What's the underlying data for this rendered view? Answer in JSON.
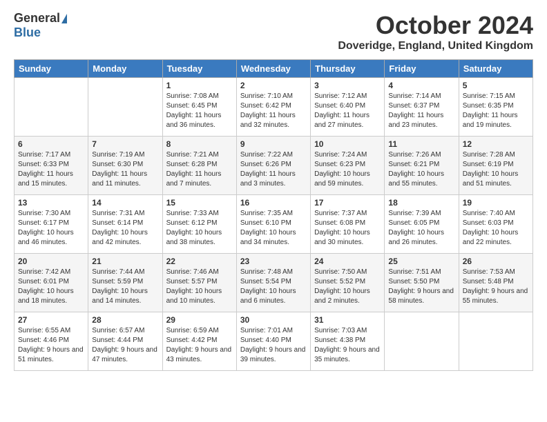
{
  "logo": {
    "general": "General",
    "blue": "Blue"
  },
  "title": "October 2024",
  "location": "Doveridge, England, United Kingdom",
  "days_of_week": [
    "Sunday",
    "Monday",
    "Tuesday",
    "Wednesday",
    "Thursday",
    "Friday",
    "Saturday"
  ],
  "weeks": [
    [
      {
        "day": null,
        "content": null
      },
      {
        "day": null,
        "content": null
      },
      {
        "day": "1",
        "content": "Sunrise: 7:08 AM\nSunset: 6:45 PM\nDaylight: 11 hours and 36 minutes."
      },
      {
        "day": "2",
        "content": "Sunrise: 7:10 AM\nSunset: 6:42 PM\nDaylight: 11 hours and 32 minutes."
      },
      {
        "day": "3",
        "content": "Sunrise: 7:12 AM\nSunset: 6:40 PM\nDaylight: 11 hours and 27 minutes."
      },
      {
        "day": "4",
        "content": "Sunrise: 7:14 AM\nSunset: 6:37 PM\nDaylight: 11 hours and 23 minutes."
      },
      {
        "day": "5",
        "content": "Sunrise: 7:15 AM\nSunset: 6:35 PM\nDaylight: 11 hours and 19 minutes."
      }
    ],
    [
      {
        "day": "6",
        "content": "Sunrise: 7:17 AM\nSunset: 6:33 PM\nDaylight: 11 hours and 15 minutes."
      },
      {
        "day": "7",
        "content": "Sunrise: 7:19 AM\nSunset: 6:30 PM\nDaylight: 11 hours and 11 minutes."
      },
      {
        "day": "8",
        "content": "Sunrise: 7:21 AM\nSunset: 6:28 PM\nDaylight: 11 hours and 7 minutes."
      },
      {
        "day": "9",
        "content": "Sunrise: 7:22 AM\nSunset: 6:26 PM\nDaylight: 11 hours and 3 minutes."
      },
      {
        "day": "10",
        "content": "Sunrise: 7:24 AM\nSunset: 6:23 PM\nDaylight: 10 hours and 59 minutes."
      },
      {
        "day": "11",
        "content": "Sunrise: 7:26 AM\nSunset: 6:21 PM\nDaylight: 10 hours and 55 minutes."
      },
      {
        "day": "12",
        "content": "Sunrise: 7:28 AM\nSunset: 6:19 PM\nDaylight: 10 hours and 51 minutes."
      }
    ],
    [
      {
        "day": "13",
        "content": "Sunrise: 7:30 AM\nSunset: 6:17 PM\nDaylight: 10 hours and 46 minutes."
      },
      {
        "day": "14",
        "content": "Sunrise: 7:31 AM\nSunset: 6:14 PM\nDaylight: 10 hours and 42 minutes."
      },
      {
        "day": "15",
        "content": "Sunrise: 7:33 AM\nSunset: 6:12 PM\nDaylight: 10 hours and 38 minutes."
      },
      {
        "day": "16",
        "content": "Sunrise: 7:35 AM\nSunset: 6:10 PM\nDaylight: 10 hours and 34 minutes."
      },
      {
        "day": "17",
        "content": "Sunrise: 7:37 AM\nSunset: 6:08 PM\nDaylight: 10 hours and 30 minutes."
      },
      {
        "day": "18",
        "content": "Sunrise: 7:39 AM\nSunset: 6:05 PM\nDaylight: 10 hours and 26 minutes."
      },
      {
        "day": "19",
        "content": "Sunrise: 7:40 AM\nSunset: 6:03 PM\nDaylight: 10 hours and 22 minutes."
      }
    ],
    [
      {
        "day": "20",
        "content": "Sunrise: 7:42 AM\nSunset: 6:01 PM\nDaylight: 10 hours and 18 minutes."
      },
      {
        "day": "21",
        "content": "Sunrise: 7:44 AM\nSunset: 5:59 PM\nDaylight: 10 hours and 14 minutes."
      },
      {
        "day": "22",
        "content": "Sunrise: 7:46 AM\nSunset: 5:57 PM\nDaylight: 10 hours and 10 minutes."
      },
      {
        "day": "23",
        "content": "Sunrise: 7:48 AM\nSunset: 5:54 PM\nDaylight: 10 hours and 6 minutes."
      },
      {
        "day": "24",
        "content": "Sunrise: 7:50 AM\nSunset: 5:52 PM\nDaylight: 10 hours and 2 minutes."
      },
      {
        "day": "25",
        "content": "Sunrise: 7:51 AM\nSunset: 5:50 PM\nDaylight: 9 hours and 58 minutes."
      },
      {
        "day": "26",
        "content": "Sunrise: 7:53 AM\nSunset: 5:48 PM\nDaylight: 9 hours and 55 minutes."
      }
    ],
    [
      {
        "day": "27",
        "content": "Sunrise: 6:55 AM\nSunset: 4:46 PM\nDaylight: 9 hours and 51 minutes."
      },
      {
        "day": "28",
        "content": "Sunrise: 6:57 AM\nSunset: 4:44 PM\nDaylight: 9 hours and 47 minutes."
      },
      {
        "day": "29",
        "content": "Sunrise: 6:59 AM\nSunset: 4:42 PM\nDaylight: 9 hours and 43 minutes."
      },
      {
        "day": "30",
        "content": "Sunrise: 7:01 AM\nSunset: 4:40 PM\nDaylight: 9 hours and 39 minutes."
      },
      {
        "day": "31",
        "content": "Sunrise: 7:03 AM\nSunset: 4:38 PM\nDaylight: 9 hours and 35 minutes."
      },
      {
        "day": null,
        "content": null
      },
      {
        "day": null,
        "content": null
      }
    ]
  ]
}
